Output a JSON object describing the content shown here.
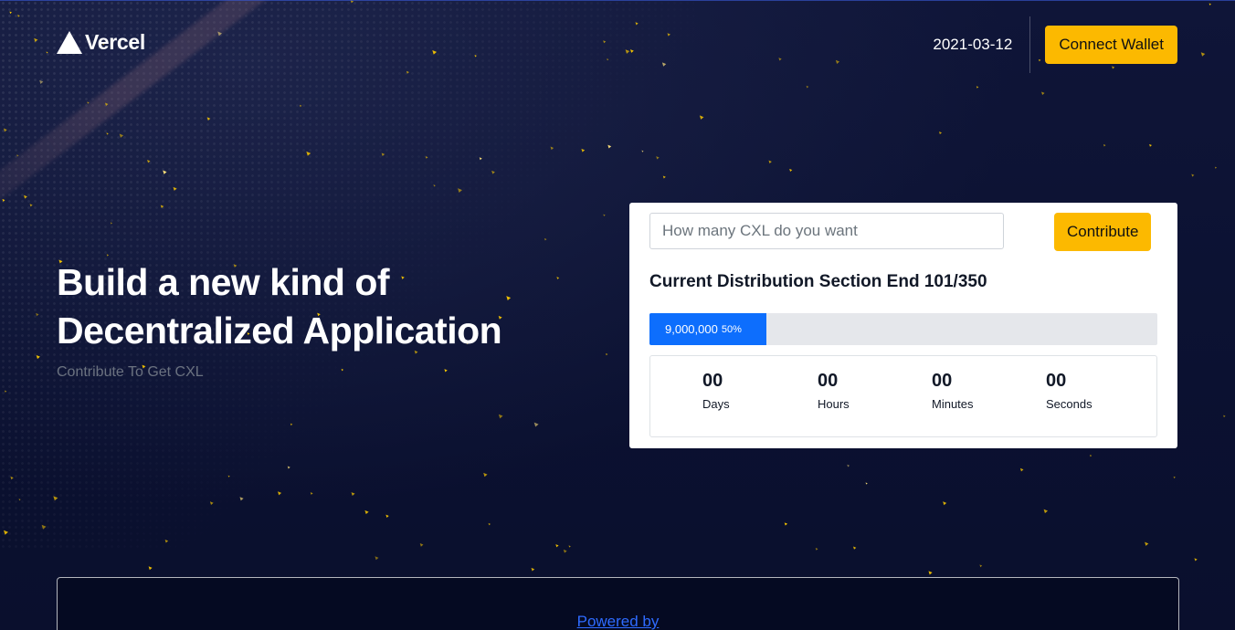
{
  "header": {
    "brand": "Vercel",
    "date": "2021-03-12",
    "connect_wallet_label": "Connect Wallet"
  },
  "hero": {
    "title_line1": "Build a new kind of",
    "title_line2": "Decentralized Application",
    "subtitle": "Contribute To Get CXL"
  },
  "contribute_card": {
    "amount_input": {
      "value": "",
      "placeholder": "How many CXL do you want"
    },
    "contribute_label": "Contribute",
    "distribution_title": "Current Distribution Section End 101/350",
    "progress": {
      "amount": "9,000,000",
      "percent_label": "50%",
      "fill_fraction": 0.23
    },
    "countdown": [
      {
        "value": "00",
        "label": "Days"
      },
      {
        "value": "00",
        "label": "Hours"
      },
      {
        "value": "00",
        "label": "Minutes"
      },
      {
        "value": "00",
        "label": "Seconds"
      }
    ]
  },
  "footer": {
    "powered_by": "Powered by"
  },
  "colors": {
    "background": "#0d1333",
    "accent_yellow": "#fcb900",
    "progress_blue": "#0d6efd",
    "link_blue": "#2e6bff"
  }
}
